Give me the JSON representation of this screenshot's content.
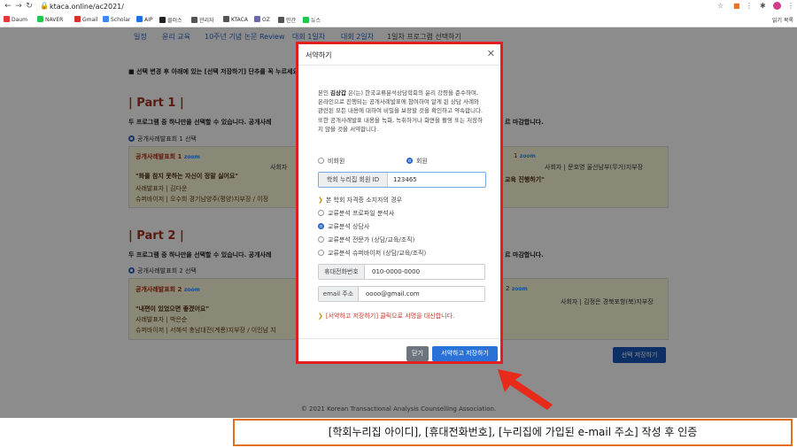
{
  "browser": {
    "url": "ktaca.online/ac2021/",
    "bookmarks": [
      "Daum",
      "NAVER",
      "Gmail",
      "Scholar",
      "AIP",
      "클러스",
      "관리자",
      "KTACA",
      "OZ",
      "민간",
      "뉴스"
    ],
    "bookmarks_right": "읽기 목록"
  },
  "tabs": [
    "일정",
    "윤리 교육",
    "10주년 기념 논문 Review",
    "대회 1일차",
    "대회 2일차",
    "1일차 프로그램 선택하기"
  ],
  "page": {
    "notice": "■ 선택 변경 후 아래에 있는 [선택 저장하기] 단추를 꼭 누르세요.",
    "part1": "| Part 1 |",
    "part1_desc": "두 프로그램 중 하나만을 선택할 수 있습니다. 공개사례",
    "part1_desc_right": "르 마감합니다.",
    "part1_radio": "공개사례발표회 1 선택",
    "card1_title": "공개사례발표회 1",
    "card1_zoom": "zoom",
    "card1_quote": "\"화를 참지 못하는 자신이 정말 싫어요\"",
    "card1_presenter": "사례발표자 | 김다운",
    "card1_supervisor": "슈퍼바이저 | 오수희 경기남양주(평양)지부장 / 이정",
    "card1_mod": "사회자",
    "card2r_num": "1",
    "card2r_zoom": "zoom",
    "card2r_mod": "사회자 | 문호영 울산남부(무거)지부장",
    "card2r_quote": "교육 진행하기\"",
    "part2": "| Part 2 |",
    "part2_desc": "두 프로그램 중 하나만을 선택할 수 있습니다. 공개사례",
    "part2_desc_right": "르 마감합니다.",
    "part2_radio": "공개사례발표회 2 선택",
    "card3_title": "공개사례발표회 2",
    "card3_zoom": "zoom",
    "card3_quote": "\"내편이 있었으면 좋겠어요\"",
    "card3_presenter": "사례발표자 | 박은순",
    "card3_supervisor": "슈퍼바이저 | 서혜석 충남대전(계룡)지부장 / 이인남 지",
    "card4r_num": "2",
    "card4r_zoom": "zoom",
    "card4r_mod": "사회자 | 김정은 경북포항(북)지부장",
    "save_btn": "선택 저장하기",
    "footer": "© 2021 Korean Transactional Analysis Counselling Association."
  },
  "modal": {
    "title": "서약하기",
    "close_x": "✕",
    "body_pre": "본인 ",
    "body_name": "김상갑",
    "body_post": " 은(는) 한국교류분석상담학회의 윤리 강령을 준수하며, 온라인으로 진행되는 공개사례발표에 참여하여 알게 된 상담 사례와 관련된 모든 내용에 대하여 비밀을 보장할 것을 확인하고 약속합니다. 또한 공개사례발표 내용을 녹화, 녹취하거나 화면을 촬영 또는 저장하지 않을 것을 서약합니다.",
    "nonmember": "비회원",
    "member": "회원",
    "member_id_label": "학회 누리집 회원 ID",
    "member_id_value": "123465",
    "cert_hint": "본 학회 자격증 소지자의 경우",
    "certs": [
      "교류분석 프로파일 분석사",
      "교류분석 상담사",
      "교류분석 전문가 (상담/교육/조직)",
      "교류분석 슈퍼바이저 (상담/교육/조직)"
    ],
    "cert_selected": 1,
    "phone_label": "휴대전화번호",
    "phone_value": "010-0000-0000",
    "email_label": "email 주소",
    "email_value": "oooo@gmail.com",
    "warn": "[서약하고 저장하기] 클릭으로 서명을 대신합니다.",
    "btn_close": "닫기",
    "btn_sign": "서약하고 저장하기"
  },
  "caption": "[학회누리집 아이디], [휴대전화번호], [누리집에 가입된 e-mail 주소] 작성 후 인증",
  "colors": {
    "accent": "#2a64c4",
    "highlight_border": "#e02020",
    "arrow": "#e82a1a",
    "caption_border": "#e07020"
  }
}
